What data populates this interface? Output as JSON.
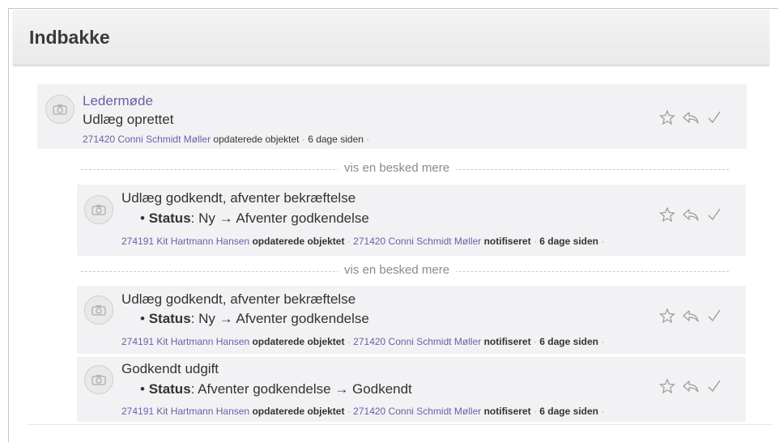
{
  "page": {
    "title": "Indbakke"
  },
  "more_label": "vis en besked mere",
  "items": [
    {
      "title": "Ledermøde",
      "subtitle": "Udlæg oprettet",
      "meta": {
        "user1": "271420 Conni Schmidt Møller",
        "action1": "opdaterede objektet",
        "time": "6 dage siden"
      }
    },
    {
      "title": "Udlæg godkendt, afventer bekræftelse",
      "status_label": "Status",
      "status_value": ": Ny → Afventer godkendelse",
      "meta": {
        "user1": "274191 Kit Hartmann Hansen",
        "action1": "opdaterede objektet",
        "user2": "271420 Conni Schmidt Møller",
        "action2": "notifiseret",
        "time": "6 dage siden"
      }
    },
    {
      "title": "Udlæg godkendt, afventer bekræftelse",
      "status_label": "Status",
      "status_value": ": Ny → Afventer godkendelse",
      "meta": {
        "user1": "274191 Kit Hartmann Hansen",
        "action1": "opdaterede objektet",
        "user2": "271420 Conni Schmidt Møller",
        "action2": "notifiseret",
        "time": "6 dage siden"
      }
    },
    {
      "title": "Godkendt udgift",
      "status_label": "Status",
      "status_value": ": Afventer godkendelse → Godkendt",
      "meta": {
        "user1": "274191 Kit Hartmann Hansen",
        "action1": "opdaterede objektet",
        "user2": "271420 Conni Schmidt Møller",
        "action2": "notifiseret",
        "time": "6 dage siden"
      }
    }
  ],
  "icons": {
    "avatar": "camera-icon",
    "star": "star-icon",
    "reply": "reply-icon",
    "check": "check-icon"
  }
}
